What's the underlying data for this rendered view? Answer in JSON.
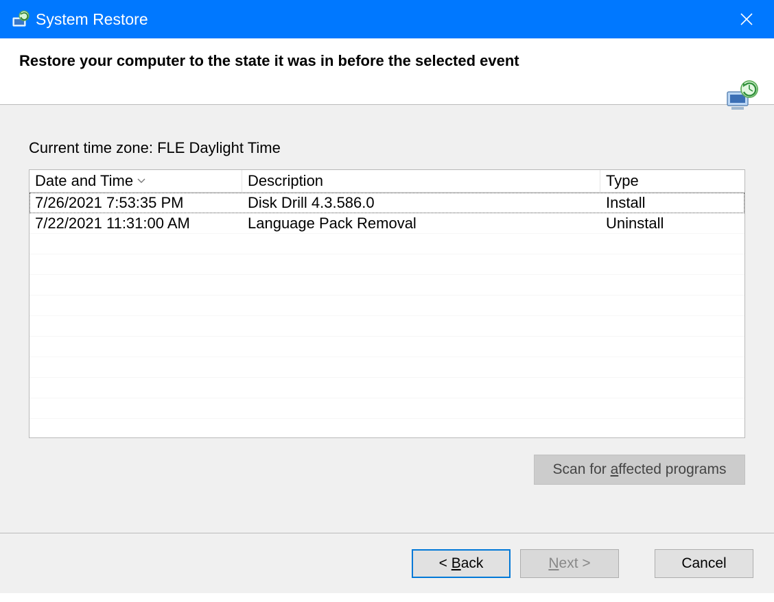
{
  "titlebar": {
    "title": "System Restore"
  },
  "header": {
    "heading": "Restore your computer to the state it was in before the selected event"
  },
  "body": {
    "timezone_label": "Current time zone: FLE Daylight Time"
  },
  "table": {
    "columns": {
      "date": "Date and Time",
      "desc": "Description",
      "type": "Type"
    },
    "rows": [
      {
        "date": "7/26/2021 7:53:35 PM",
        "desc": "Disk Drill 4.3.586.0",
        "type": "Install",
        "selected": true
      },
      {
        "date": "7/22/2021 11:31:00 AM",
        "desc": "Language Pack Removal",
        "type": "Uninstall",
        "selected": false
      }
    ]
  },
  "buttons": {
    "scan_prefix": "Scan for ",
    "scan_accel": "a",
    "scan_suffix": "ffected programs",
    "back_prefix": "< ",
    "back_accel": "B",
    "back_suffix": "ack",
    "next_accel": "N",
    "next_suffix": "ext >",
    "cancel": "Cancel"
  }
}
